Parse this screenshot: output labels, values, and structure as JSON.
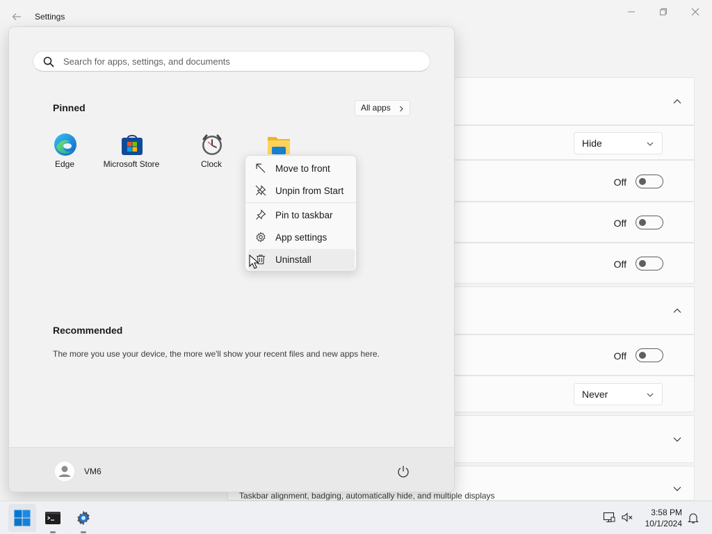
{
  "settings": {
    "title": "Settings",
    "rows": {
      "dropdown_1_value": "Hide",
      "toggle_1_label": "Off",
      "toggle_2_label": "Off",
      "toggle_3_label": "Off",
      "toggle_4_label": "Off",
      "dropdown_2_value": "Never",
      "toggle_1": false,
      "toggle_2": false,
      "toggle_3": false,
      "toggle_4": false
    },
    "taskbar_behaviors_desc": "Taskbar alignment, badging, automatically hide, and multiple displays"
  },
  "start_menu": {
    "search_placeholder": "Search for apps, settings, and documents",
    "pinned_title": "Pinned",
    "all_apps_label": "All apps",
    "pinned_apps": [
      {
        "label": "Edge",
        "icon": "edge-icon"
      },
      {
        "label": "Microsoft Store",
        "icon": "microsoft-store-icon"
      },
      {
        "label": "Clock",
        "icon": "clock-icon"
      },
      {
        "label": "",
        "icon": "file-explorer-icon"
      }
    ],
    "recommended_title": "Recommended",
    "recommended_text": "The more you use your device, the more we'll show your recent files and new apps here.",
    "user_name": "VM6"
  },
  "context_menu": {
    "items": [
      {
        "label": "Move to front",
        "icon": "move-to-front-icon"
      },
      {
        "label": "Unpin from Start",
        "icon": "unpin-icon"
      },
      {
        "label": "Pin to taskbar",
        "icon": "pin-icon"
      },
      {
        "label": "App settings",
        "icon": "gear-icon"
      },
      {
        "label": "Uninstall",
        "icon": "trash-icon"
      }
    ],
    "hovered": "Uninstall"
  },
  "taskbar": {
    "time": "3:58 PM",
    "date": "10/1/2024",
    "apps": [
      "start-icon",
      "terminal-icon",
      "settings-icon"
    ]
  },
  "colors": {
    "accent": "#0067c0",
    "toggle_off": "#5f5f5f"
  }
}
